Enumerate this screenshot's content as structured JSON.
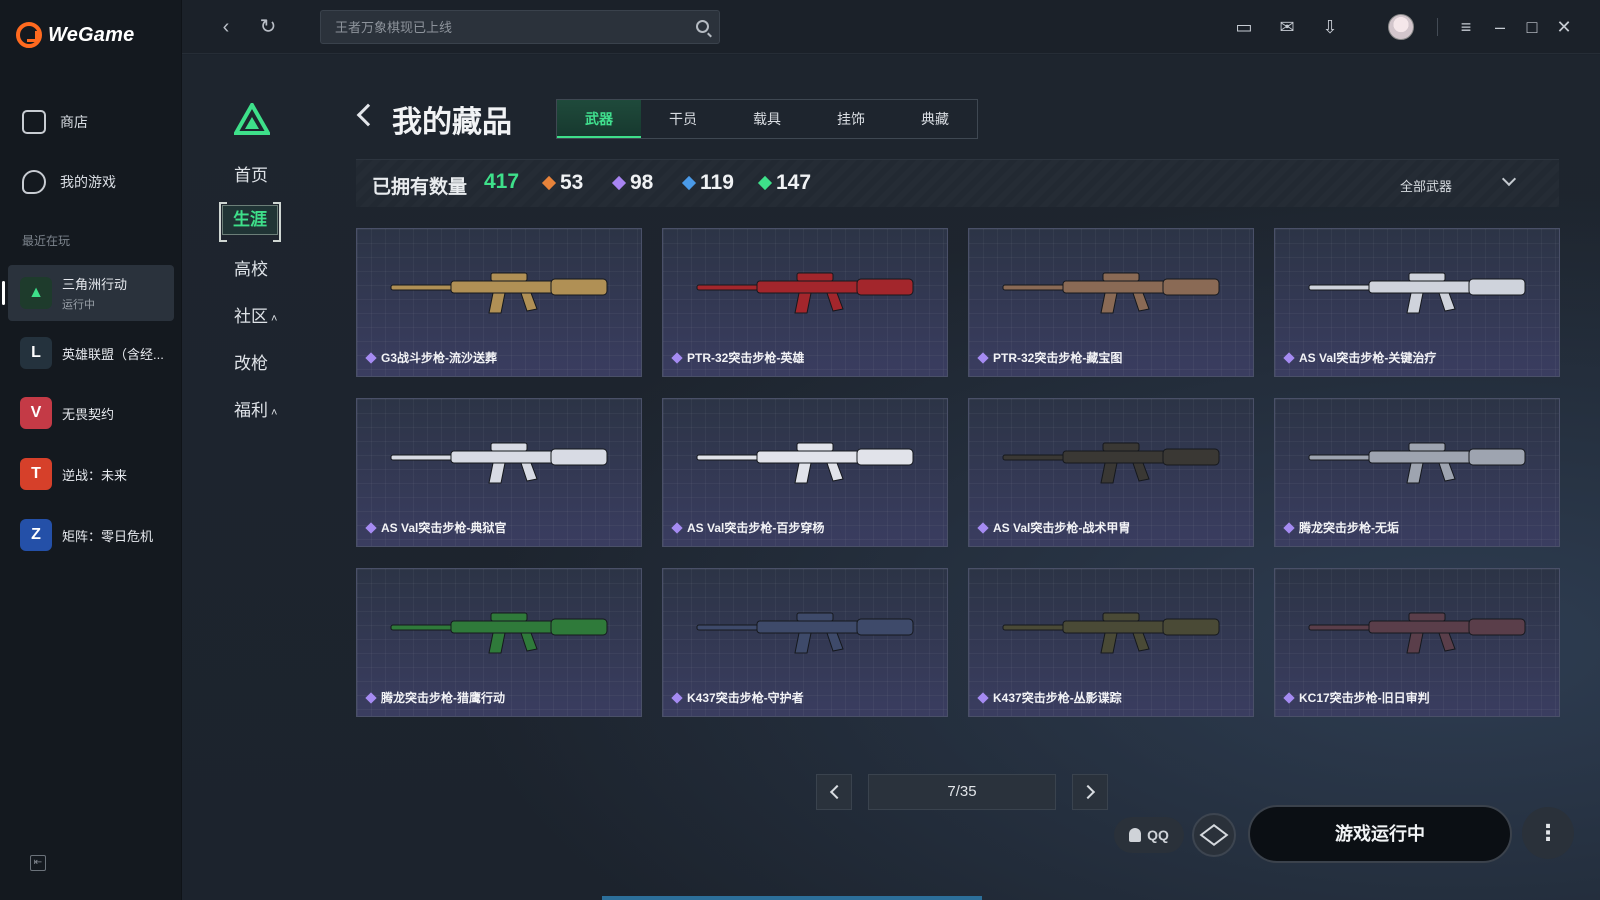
{
  "app": {
    "name": "WeGame"
  },
  "sidebar": {
    "store_label": "商店",
    "my_games_label": "我的游戏",
    "recent_label": "最近在玩",
    "games": [
      {
        "name": "三角洲行动",
        "status": "运行中",
        "icon": "delta-force-icon",
        "color": "#1e3b2c"
      },
      {
        "name": "英雄联盟（含经...",
        "status": "",
        "icon": "league-of-legends-icon",
        "color": "#24323d"
      },
      {
        "name": "无畏契约",
        "status": "",
        "icon": "valorant-icon",
        "color": "#c43a46"
      },
      {
        "name": "逆战：未来",
        "status": "",
        "icon": "nizhan-icon",
        "color": "#d6402a"
      },
      {
        "name": "矩阵：零日危机",
        "status": "",
        "icon": "matrix-icon",
        "color": "#2450a8"
      }
    ]
  },
  "topbar": {
    "search_placeholder": "王者万象棋现已上线"
  },
  "subnav": {
    "items": [
      "首页",
      "生涯",
      "高校",
      "社区",
      "改枪",
      "福利"
    ],
    "active": "生涯"
  },
  "page": {
    "title": "我的藏品",
    "tabs": [
      "武器",
      "干员",
      "载具",
      "挂饰",
      "典藏"
    ],
    "active_tab": "武器"
  },
  "stats": {
    "owned_label": "已拥有数量",
    "owned_count": "417",
    "rarities": [
      {
        "value": "53",
        "color": "#e8833a"
      },
      {
        "value": "98",
        "color": "#a884f2"
      },
      {
        "value": "119",
        "color": "#4a9ae8"
      },
      {
        "value": "147",
        "color": "#3ee08a"
      }
    ],
    "filter_label": "全部武器"
  },
  "items": [
    {
      "name": "G3战斗步枪-流沙送葬",
      "color": "#b09055"
    },
    {
      "name": "PTR-32突击步枪-英雄",
      "color": "#a3262c"
    },
    {
      "name": "PTR-32突击步枪-藏宝图",
      "color": "#8a6a55"
    },
    {
      "name": "AS Val突击步枪-关键治疗",
      "color": "#cfd3dc"
    },
    {
      "name": "AS Val突击步枪-典狱官",
      "color": "#d8dbe4"
    },
    {
      "name": "AS Val突击步枪-百步穿杨",
      "color": "#e1e3ea"
    },
    {
      "name": "AS Val突击步枪-战术甲胄",
      "color": "#3a3834"
    },
    {
      "name": "腾龙突击步枪-无垢",
      "color": "#9ea4b0"
    },
    {
      "name": "腾龙突击步枪-猎鹰行动",
      "color": "#2f7a3a"
    },
    {
      "name": "K437突击步枪-守护者",
      "color": "#3e4a6a"
    },
    {
      "name": "K437突击步枪-丛影谍踪",
      "color": "#4a4a36"
    },
    {
      "name": "KC17突击步枪-旧日审判",
      "color": "#5a3e4a"
    }
  ],
  "pagination": {
    "indicator": "7/35"
  },
  "footer": {
    "qq_label": "QQ",
    "play_label": "游戏运行中",
    "more_label": "⋮"
  }
}
